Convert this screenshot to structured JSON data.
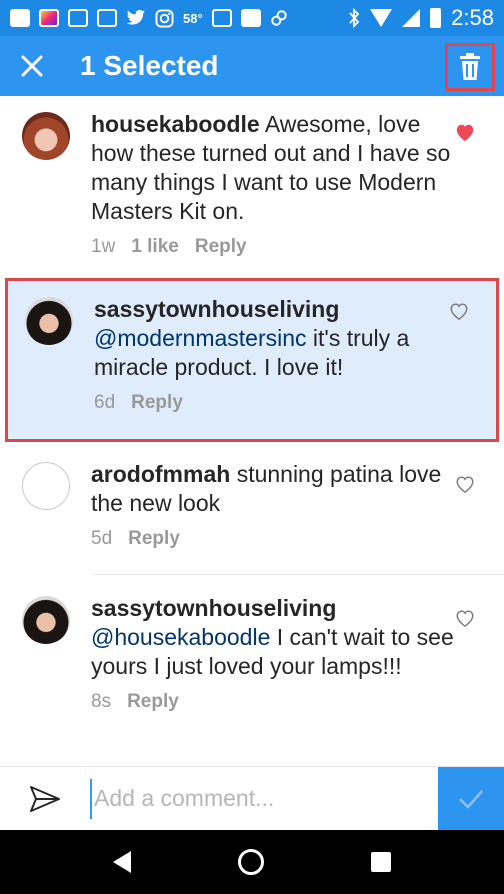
{
  "status_bar": {
    "temperature": "58°",
    "time": "2:58",
    "icons": [
      "messaging-icon",
      "app-icon",
      "gmail-icon",
      "gmail-icon",
      "twitter-icon",
      "instagram-icon",
      "calendar-icon",
      "photos-icon",
      "link-icon",
      "bluetooth-icon",
      "wifi-icon",
      "signal-icon",
      "battery-icon"
    ]
  },
  "action_bar": {
    "title": "1 Selected",
    "close_icon": "close-icon",
    "delete_icon": "trash-icon",
    "accent_color": "#2d95f0",
    "highlight_color": "#e0474c"
  },
  "comments": [
    {
      "username": "housekaboodle",
      "text": "Awesome, love how these turned out and I have so many things I want to use Modern Masters Kit on.",
      "time": "1w",
      "likes": "1 like",
      "reply": "Reply",
      "liked": true,
      "selected": false
    },
    {
      "username": "sassytownhouseliving",
      "mention": "@modernmastersinc",
      "text": "it's truly a miracle product. I love it!",
      "time": "6d",
      "reply": "Reply",
      "liked": false,
      "selected": true
    },
    {
      "username": "arodofmmah",
      "text": "stunning patina love the new look",
      "time": "5d",
      "reply": "Reply",
      "liked": false,
      "selected": false
    },
    {
      "username": "sassytownhouseliving",
      "mention": "@housekaboodle",
      "text": "I can't wait to see yours I just loved your lamps!!!",
      "time": "8s",
      "reply": "Reply",
      "liked": false,
      "selected": false
    }
  ],
  "composer": {
    "placeholder": "Add a comment...",
    "value": ""
  }
}
